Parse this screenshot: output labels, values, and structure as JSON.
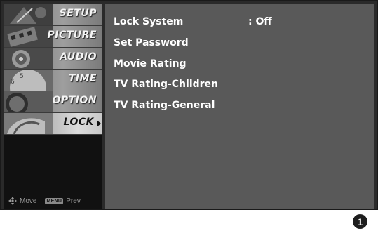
{
  "sidebar": {
    "items": [
      {
        "label": "SETUP"
      },
      {
        "label": "PICTURE"
      },
      {
        "label": "AUDIO"
      },
      {
        "label": "TIME"
      },
      {
        "label": "OPTION"
      },
      {
        "label": "LOCK"
      }
    ],
    "active_item": "LOCK",
    "footer": {
      "move_label": "Move",
      "menu_badge": "MENU",
      "prev_label": "Prev"
    }
  },
  "lock_menu": {
    "options": [
      {
        "label": "Lock System",
        "value": ": Off"
      },
      {
        "label": "Set Password"
      },
      {
        "label": "Movie Rating"
      },
      {
        "label": "TV Rating-Children"
      },
      {
        "label": "TV Rating-General"
      }
    ]
  },
  "step_badge": "1",
  "colors": {
    "content_bg": "#595959",
    "sidebar_bg": "#111111",
    "frame": "#2a2a2a",
    "text": "#ffffff"
  }
}
